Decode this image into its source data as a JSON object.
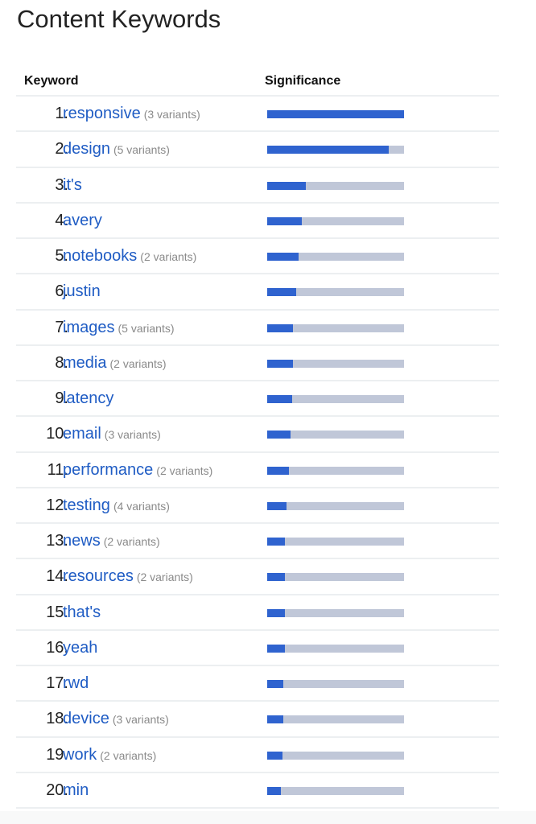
{
  "page": {
    "title": "Content Keywords"
  },
  "table": {
    "headers": {
      "keyword": "Keyword",
      "significance": "Significance"
    }
  },
  "colors": {
    "link": "#1f5cc4",
    "bar_fill": "#2f63cf",
    "bar_track": "#c0c7d8",
    "divider": "#eceff1"
  },
  "chart_data": {
    "type": "bar",
    "title": "Content Keywords",
    "xlabel": "Significance",
    "ylabel": "Keyword",
    "xlim": [
      0,
      1
    ],
    "categories": [
      "responsive",
      "design",
      "it's",
      "avery",
      "notebooks",
      "justin",
      "images",
      "media",
      "latency",
      "email",
      "performance",
      "testing",
      "news",
      "resources",
      "that's",
      "yeah",
      "rwd",
      "device",
      "work",
      "min"
    ],
    "values": [
      1.0,
      0.89,
      0.28,
      0.25,
      0.23,
      0.21,
      0.19,
      0.19,
      0.18,
      0.17,
      0.16,
      0.14,
      0.13,
      0.13,
      0.13,
      0.13,
      0.12,
      0.12,
      0.11,
      0.1
    ],
    "rows": [
      {
        "rank": "1.",
        "keyword": "responsive",
        "variants": "(3 variants)",
        "significance": 1.0
      },
      {
        "rank": "2.",
        "keyword": "design",
        "variants": "(5 variants)",
        "significance": 0.89
      },
      {
        "rank": "3.",
        "keyword": "it's",
        "variants": "",
        "significance": 0.28
      },
      {
        "rank": "4.",
        "keyword": "avery",
        "variants": "",
        "significance": 0.25
      },
      {
        "rank": "5.",
        "keyword": "notebooks",
        "variants": "(2 variants)",
        "significance": 0.23
      },
      {
        "rank": "6.",
        "keyword": "justin",
        "variants": "",
        "significance": 0.21
      },
      {
        "rank": "7.",
        "keyword": "images",
        "variants": "(5 variants)",
        "significance": 0.19
      },
      {
        "rank": "8.",
        "keyword": "media",
        "variants": "(2 variants)",
        "significance": 0.19
      },
      {
        "rank": "9.",
        "keyword": "latency",
        "variants": "",
        "significance": 0.18
      },
      {
        "rank": "10.",
        "keyword": "email",
        "variants": "(3 variants)",
        "significance": 0.17
      },
      {
        "rank": "11.",
        "keyword": "performance",
        "variants": "(2 variants)",
        "significance": 0.16
      },
      {
        "rank": "12.",
        "keyword": "testing",
        "variants": "(4 variants)",
        "significance": 0.14
      },
      {
        "rank": "13.",
        "keyword": "news",
        "variants": "(2 variants)",
        "significance": 0.13
      },
      {
        "rank": "14.",
        "keyword": "resources",
        "variants": "(2 variants)",
        "significance": 0.13
      },
      {
        "rank": "15.",
        "keyword": "that's",
        "variants": "",
        "significance": 0.13
      },
      {
        "rank": "16.",
        "keyword": "yeah",
        "variants": "",
        "significance": 0.13
      },
      {
        "rank": "17.",
        "keyword": "rwd",
        "variants": "",
        "significance": 0.12
      },
      {
        "rank": "18.",
        "keyword": "device",
        "variants": "(3 variants)",
        "significance": 0.12
      },
      {
        "rank": "19.",
        "keyword": "work",
        "variants": "(2 variants)",
        "significance": 0.11
      },
      {
        "rank": "20.",
        "keyword": "min",
        "variants": "",
        "significance": 0.1
      }
    ]
  }
}
